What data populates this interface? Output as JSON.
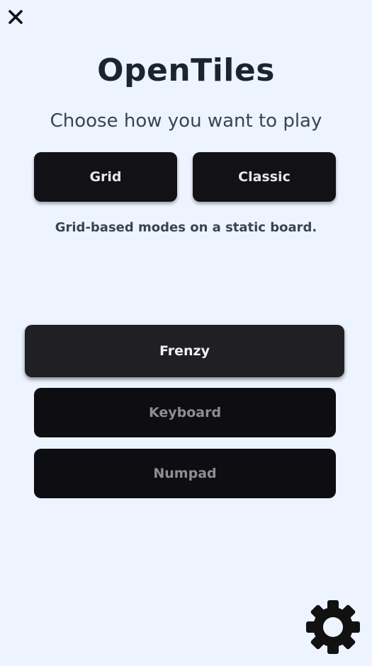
{
  "app": {
    "title": "OpenTiles",
    "subtitle": "Choose how you want to play"
  },
  "mode_tabs": [
    {
      "label": "Grid"
    },
    {
      "label": "Classic"
    }
  ],
  "mode_description": "Grid-based modes on a static board.",
  "game_modes": [
    {
      "label": "Frenzy",
      "state": "highlighted"
    },
    {
      "label": "Keyboard",
      "state": "muted"
    },
    {
      "label": "Numpad",
      "state": "muted"
    }
  ],
  "icons": {
    "close": "close-icon",
    "settings": "gear-icon"
  },
  "colors": {
    "background": "#edf4ff",
    "button_dark": "#121216",
    "button_highlight": "#1f1f24",
    "text_dark": "#1c2430",
    "text_muted": "#8d8d94"
  }
}
